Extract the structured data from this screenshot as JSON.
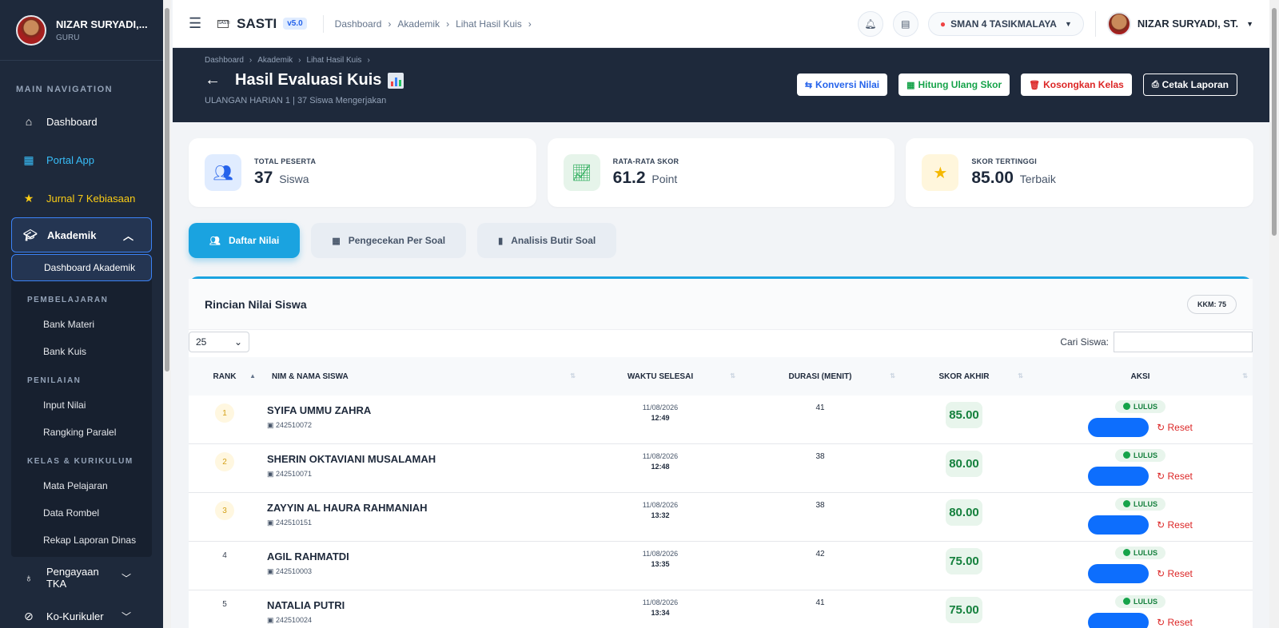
{
  "sidebar": {
    "user_name": "NIZAR SURYADI,...",
    "user_role": "GURU",
    "section_title": "MAIN NAVIGATION",
    "nav": {
      "dashboard": "Dashboard",
      "portal": "Portal App",
      "jurnal": "Jurnal 7 Kebiasaan",
      "akademik": "Akademik",
      "pengayaan": "Pengayaan TKA",
      "kokurikuler": "Ko-Kurikuler"
    },
    "submenu": {
      "active": "Dashboard Akademik",
      "groups": [
        {
          "title": "PEMBELAJARAN",
          "items": [
            "Bank Materi",
            "Bank Kuis"
          ]
        },
        {
          "title": "PENILAIAN",
          "items": [
            "Input Nilai",
            "Rangking Paralel"
          ]
        },
        {
          "title": "KELAS & KURIKULUM",
          "items": [
            "Mata Pelajaran",
            "Data Rombel",
            "Rekap Laporan Dinas"
          ]
        }
      ]
    }
  },
  "topbar": {
    "brand": "SASTI",
    "logo_text": "SASTI",
    "version": "v5.0",
    "breadcrumb": [
      "Dashboard",
      "Akademik",
      "Lihat Hasil Kuis"
    ],
    "school": "SMAN 4 TASIKMALAYA",
    "user": "NIZAR SURYADI, ST."
  },
  "hero": {
    "breadcrumb": [
      "Dashboard",
      "Akademik",
      "Lihat Hasil Kuis"
    ],
    "title": "Hasil Evaluasi Kuis",
    "subtitle": "ULANGAN HARIAN 1 | 37 Siswa Mengerjakan",
    "buttons": {
      "konversi": "Konversi Nilai",
      "hitung": "Hitung Ulang Skor",
      "kosongkan": "Kosongkan Kelas",
      "cetak": "Cetak Laporan"
    }
  },
  "stats": {
    "peserta": {
      "label": "TOTAL PESERTA",
      "value": "37",
      "unit": "Siswa"
    },
    "rata": {
      "label": "RATA-RATA SKOR",
      "value": "61.2",
      "unit": "Point"
    },
    "tertinggi": {
      "label": "SKOR TERTINGGI",
      "value": "85.00",
      "unit": "Terbaik"
    }
  },
  "tabs": {
    "daftar": "Daftar Nilai",
    "pengecekan": "Pengecekan Per Soal",
    "analisis": "Analisis Butir Soal"
  },
  "panel": {
    "title": "Rincian Nilai Siswa",
    "kkm": "KKM: 75",
    "page_size": "25",
    "search_label": "Cari Siswa:",
    "columns": [
      "RANK",
      "NIM & NAMA SISWA",
      "WAKTU SELESAI",
      "DURASI (MENIT)",
      "SKOR AKHIR",
      "AKSI"
    ],
    "status_label": "LULUS",
    "reset_label": "Reset",
    "rows": [
      {
        "rank": "1",
        "name": "SYIFA UMMU ZAHRA",
        "nim": "242510072",
        "date": "11/08/2026",
        "time": "12:49",
        "duration": "41",
        "score": "85.00"
      },
      {
        "rank": "2",
        "name": "SHERIN OKTAVIANI MUSALAMAH",
        "nim": "242510071",
        "date": "11/08/2026",
        "time": "12:48",
        "duration": "38",
        "score": "80.00"
      },
      {
        "rank": "3",
        "name": "ZAYYIN AL HAURA RAHMANIAH",
        "nim": "242510151",
        "date": "11/08/2026",
        "time": "13:32",
        "duration": "38",
        "score": "80.00"
      },
      {
        "rank": "4",
        "name": "AGIL RAHMATDI",
        "nim": "242510003",
        "date": "11/08/2026",
        "time": "13:35",
        "duration": "42",
        "score": "75.00"
      },
      {
        "rank": "5",
        "name": "NATALIA PUTRI",
        "nim": "242510024",
        "date": "11/08/2026",
        "time": "13:34",
        "duration": "41",
        "score": "75.00"
      }
    ]
  },
  "colors": {
    "accent": "#1aa3e0",
    "sidebar": "#1e293b",
    "success": "#15803d",
    "danger": "#dc2626",
    "primary": "#0d6efd"
  }
}
